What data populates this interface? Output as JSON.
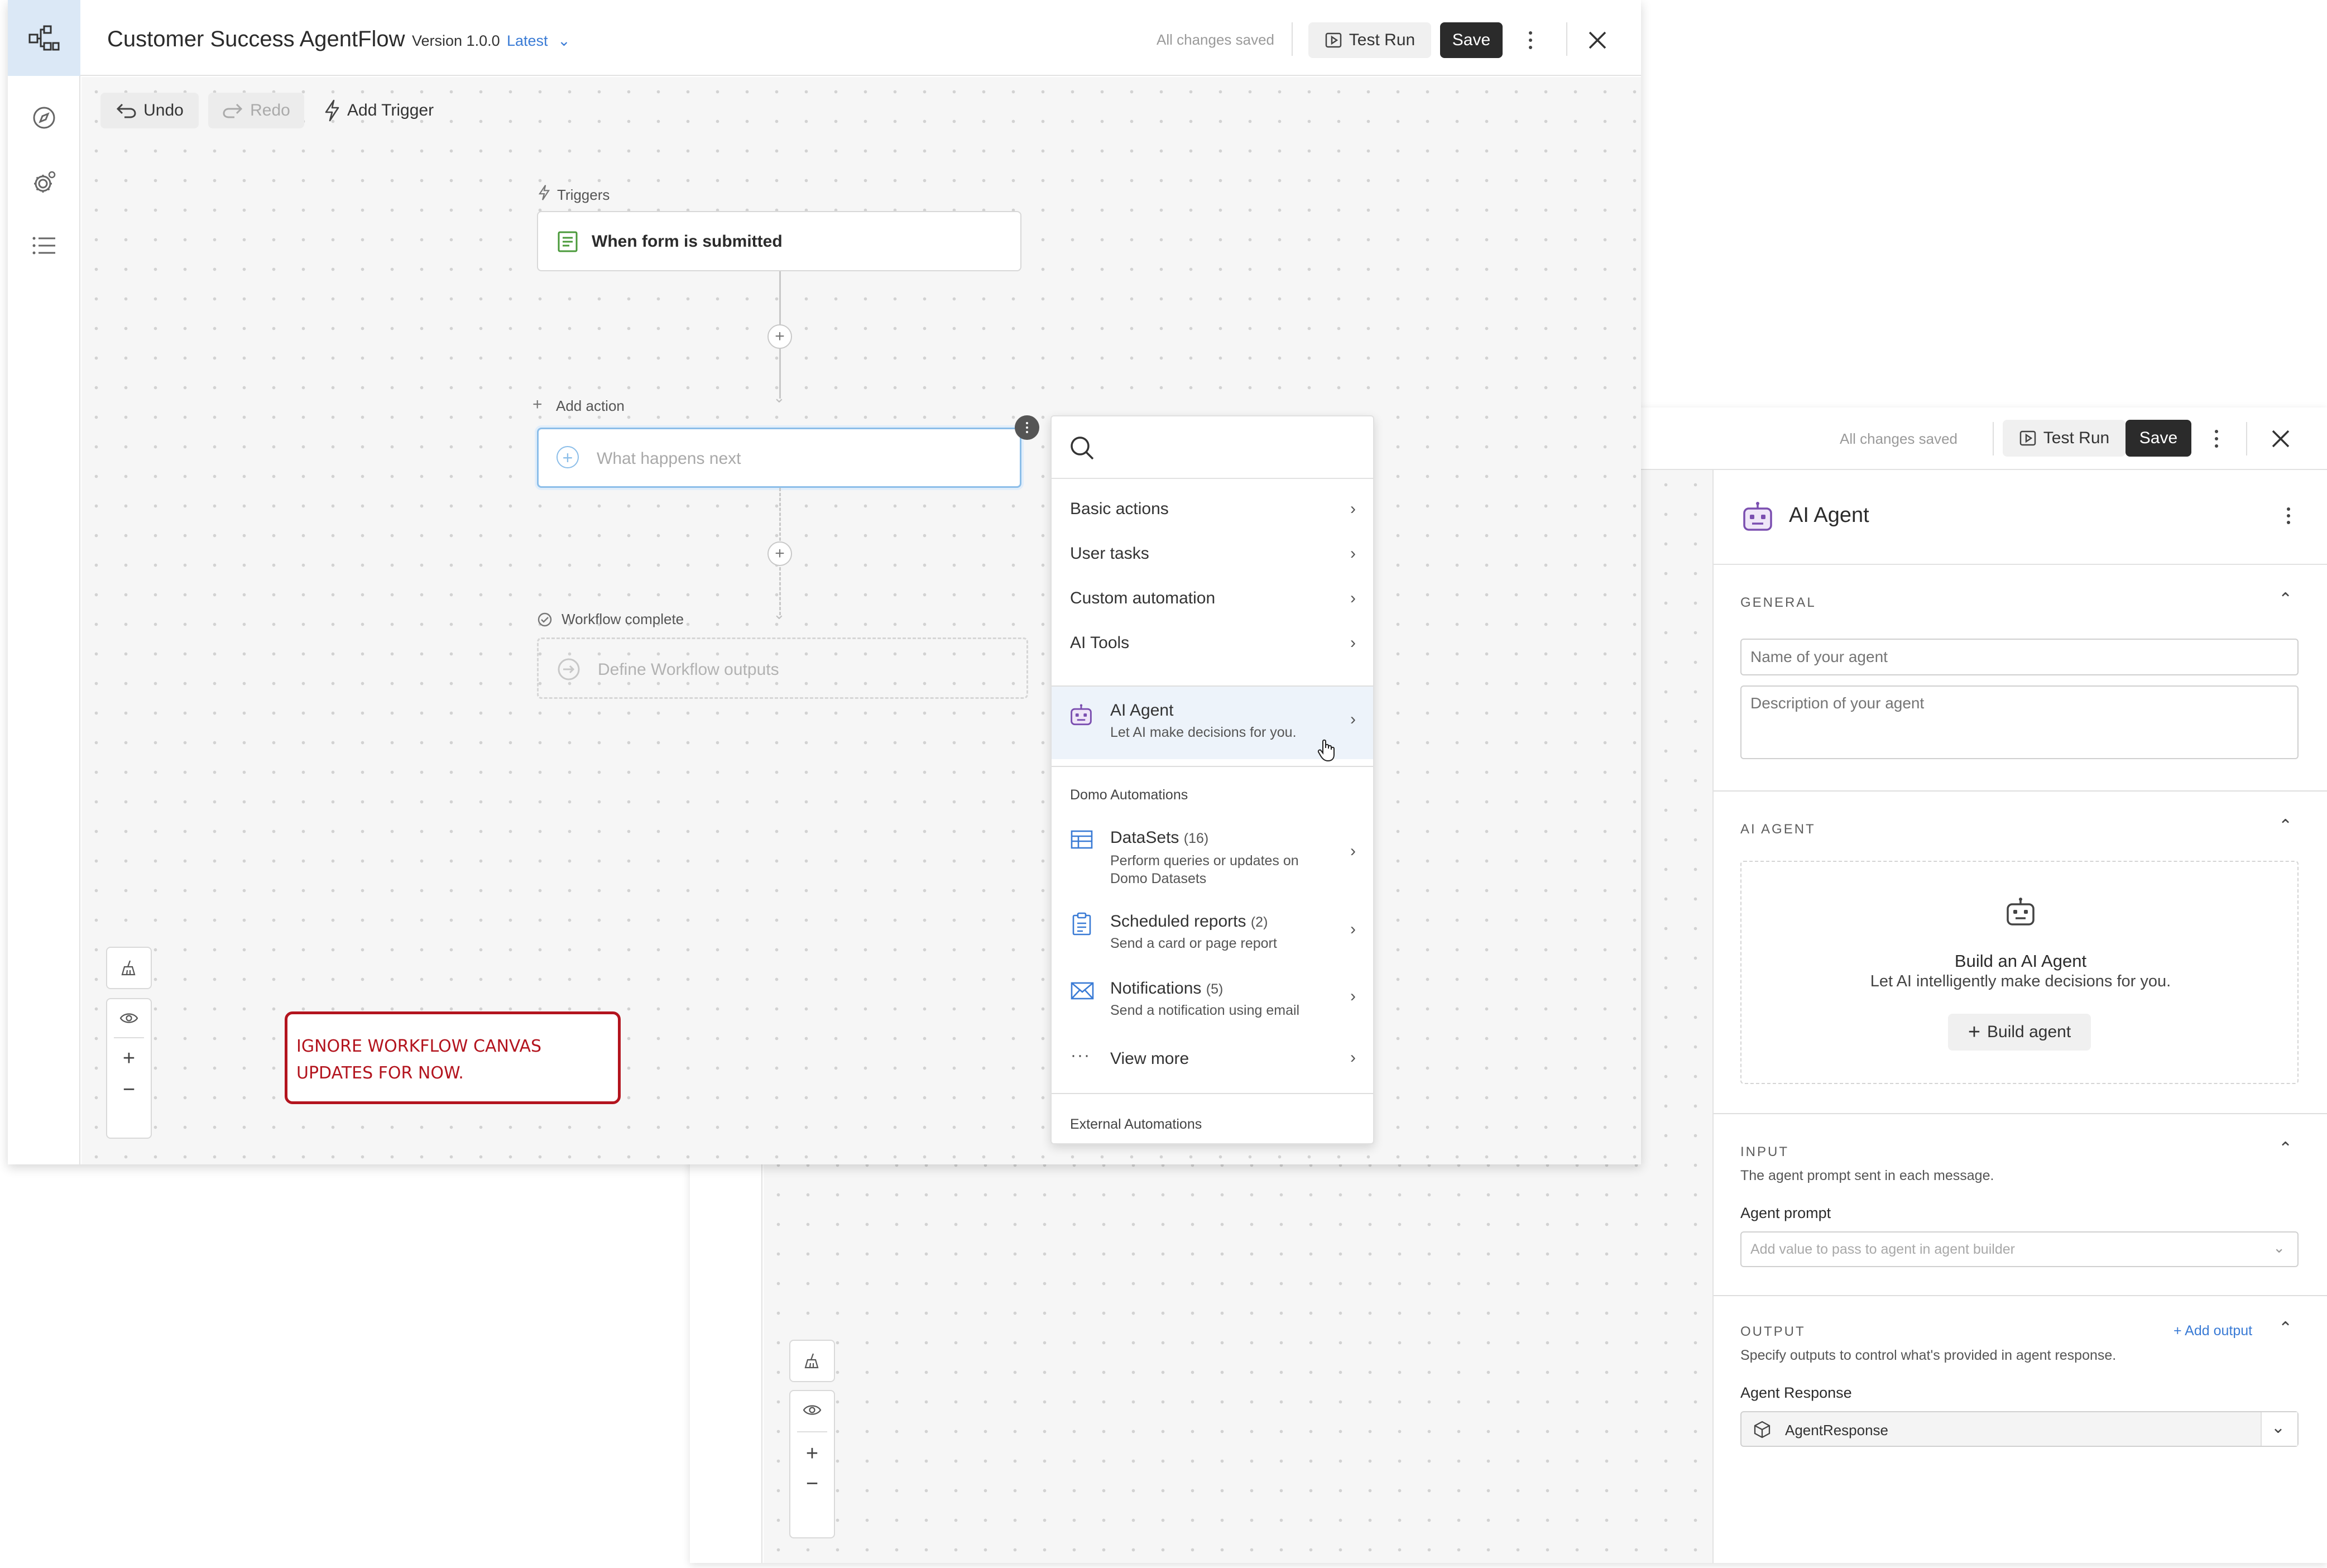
{
  "back_window": {
    "header": {
      "all_changes_saved": "All changes saved",
      "test_run_label": "Test Run",
      "save_label": "Save"
    },
    "panel": {
      "title": "AI Agent",
      "general": {
        "heading": "GENERAL",
        "name_placeholder": "Name of your agent",
        "description_placeholder": "Description of your agent"
      },
      "ai_agent": {
        "heading": "AI AGENT",
        "build_title": "Build an AI Agent",
        "build_subtitle": "Let AI intelligently make decisions for you.",
        "build_button": "Build agent"
      },
      "input": {
        "heading": "INPUT",
        "description": "The agent prompt sent in each message.",
        "prompt_label": "Agent prompt",
        "prompt_placeholder": "Add value to pass to agent in agent builder"
      },
      "output": {
        "heading": "OUTPUT",
        "add_output": "+ Add output",
        "description": "Specify outputs to control what's provided in agent response.",
        "response_label": "Agent Response",
        "response_value": "AgentResponse"
      }
    }
  },
  "front_window": {
    "header": {
      "title": "Customer Success AgentFlow",
      "version": "Version 1.0.0",
      "version_tag": "Latest",
      "all_changes_saved": "All changes saved",
      "test_run_label": "Test Run",
      "save_label": "Save"
    },
    "toolbar": {
      "undo": "Undo",
      "redo": "Redo",
      "add_trigger": "Add Trigger"
    },
    "flow": {
      "triggers_label": "Triggers",
      "trigger_node": "When form is submitted",
      "add_action_label": "Add action",
      "action_placeholder": "What happens next",
      "complete_label": "Workflow complete",
      "outputs_placeholder": "Define Workflow outputs"
    },
    "annotation": "IGNORE WORKFLOW CANVAS UPDATES FOR NOW."
  },
  "action_menu": {
    "search_placeholder": "",
    "basic_items": [
      {
        "label": "Basic actions"
      },
      {
        "label": "User tasks"
      },
      {
        "label": "Custom automation"
      },
      {
        "label": "AI Tools"
      }
    ],
    "ai_agent": {
      "title": "AI Agent",
      "subtitle": "Let AI make decisions for you."
    },
    "domo_heading": "Domo Automations",
    "domo_items": [
      {
        "title": "DataSets",
        "count": "(16)",
        "subtitle": "Perform queries or updates on Domo Datasets"
      },
      {
        "title": "Scheduled reports",
        "count": "(2)",
        "subtitle": "Send a card or page report"
      },
      {
        "title": "Notifications",
        "count": "(5)",
        "subtitle": "Send a notification using email"
      }
    ],
    "view_more": "View more",
    "external_heading": "External Automations"
  },
  "icons": {
    "nav": [
      "workflow-icon",
      "compass-icon",
      "gear-icon",
      "list-icon"
    ],
    "accent_purple": "#7b4fb0",
    "accent_blue": "#3a7bd5",
    "annotation_red": "#b3141e"
  }
}
